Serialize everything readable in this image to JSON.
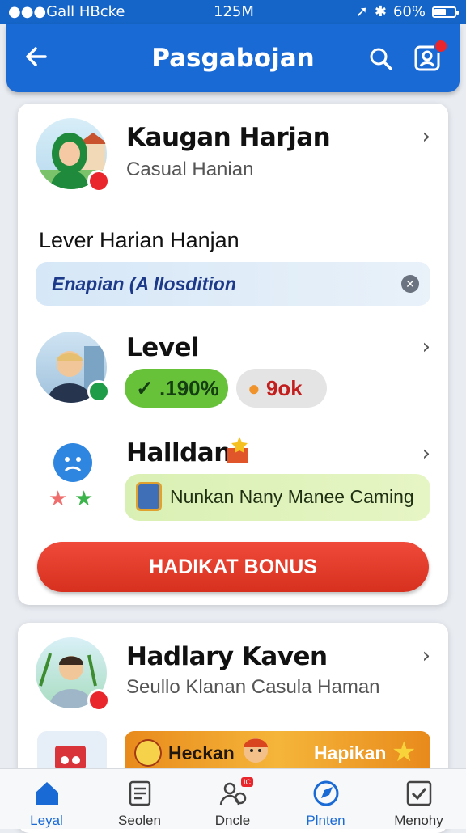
{
  "status_bar": {
    "carrier": "●●●Gall HBcke",
    "time": "125M",
    "battery": "60%",
    "battery_level": 0.6
  },
  "app_bar": {
    "title": "Pasgabojan"
  },
  "card1": {
    "row1": {
      "title": "Kaugan Harjan",
      "subtitle": "Casual Hanian"
    },
    "section_label": "Lever Harian Hanjan",
    "info_pill": "Enapian (A Ilosdition",
    "row2": {
      "title": "Level",
      "green_pill": ".190%",
      "gray_pill": "9ok"
    },
    "row3": {
      "title": "Halldan",
      "promo_text": "Nunkan Nany Manee Caming"
    },
    "bonus_button": "HADIKAT BONUS"
  },
  "card2": {
    "row1": {
      "title": "Hadlary Kaven",
      "subtitle": "Seullo Klanan Casula Haman"
    },
    "banner": {
      "left_text": "Heckan",
      "right_text": "Hapikan"
    }
  },
  "bottom_nav": [
    {
      "label": "Leyal",
      "icon": "home-icon",
      "active": true
    },
    {
      "label": "Seolen",
      "icon": "document-icon",
      "active": false
    },
    {
      "label": "Dncle",
      "icon": "people-icon",
      "active": false,
      "badge": "IC"
    },
    {
      "label": "Plnten",
      "icon": "compass-icon",
      "active": false
    },
    {
      "label": "Menohy",
      "icon": "checkbox-icon",
      "active": false
    }
  ],
  "colors": {
    "primary": "#1a6ad6",
    "bonus": "#e2392a",
    "nav_active": "#1a6ad6"
  }
}
